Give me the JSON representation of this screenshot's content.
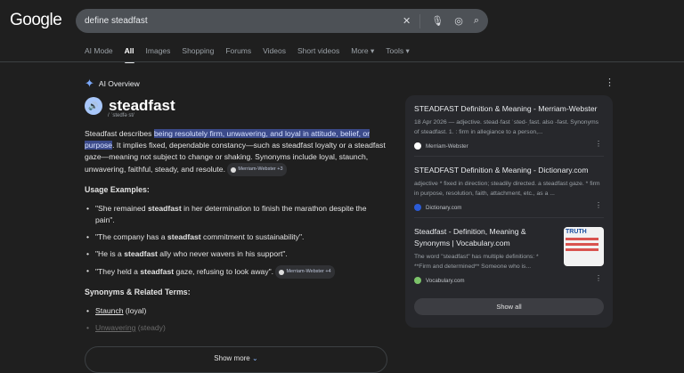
{
  "header": {
    "logo": "Google",
    "query": "define steadfast"
  },
  "tabs": [
    {
      "label": "AI Mode"
    },
    {
      "label": "All",
      "active": true
    },
    {
      "label": "Images"
    },
    {
      "label": "Shopping"
    },
    {
      "label": "Forums"
    },
    {
      "label": "Videos"
    },
    {
      "label": "Short videos"
    },
    {
      "label": "More ▾"
    },
    {
      "label": "Tools ▾"
    }
  ],
  "overview": {
    "label": "AI Overview",
    "word": "steadfast",
    "pronunciation": "/ ˈstedfə st/",
    "desc_before": "Steadfast describes ",
    "desc_highlight": "being resolutely firm, unwavering, and loyal in attitude, belief, or purpose",
    "desc_after": ". It implies fixed, dependable constancy—such as steadfast loyalty or a steadfast gaze—meaning not subject to change or shaking. Synonyms include loyal, staunch, unwavering, faithful, steady, and resolute.",
    "desc_cite": "Merriam-Webster +3",
    "usage_heading": "Usage Examples:",
    "examples": [
      {
        "before": "\"She remained ",
        "bold": "steadfast",
        "after": " in her determination to finish the marathon despite the pain\"."
      },
      {
        "before": "\"The company has a ",
        "bold": "steadfast",
        "after": " commitment to sustainability\"."
      },
      {
        "before": "\"He is a ",
        "bold": "steadfast",
        "after": " ally who never wavers in his support\"."
      },
      {
        "before": "\"They held a ",
        "bold": "steadfast",
        "after": " gaze, refusing to look away\".",
        "cite": "Merriam-Webster +4"
      }
    ],
    "synonyms_heading": "Synonyms & Related Terms:",
    "synonyms": [
      {
        "term": "Staunch",
        "note": " (loyal)"
      },
      {
        "term": "Unwavering",
        "note": " (steady)"
      }
    ],
    "show_more": "Show more"
  },
  "sources": [
    {
      "title": "STEADFAST Definition & Meaning - Merriam-Webster",
      "snippet": "18 Apr 2026 — adjective. stead·fast ˈsted-ˌfast. also -fəst. Synonyms of steadfast. 1. : firm in allegiance to a person,...",
      "site": "Merriam-Webster",
      "color": "#ffffff"
    },
    {
      "title": "STEADFAST Definition & Meaning - Dictionary.com",
      "snippet": "adjective * fixed in direction; steadily directed. a steadfast gaze. * firm in purpose, resolution, faith, attachment, etc., as a ...",
      "site": "Dictionary.com",
      "color": "#2b5bd7"
    },
    {
      "title": "Steadfast - Definition, Meaning & Synonyms | Vocabulary.com",
      "snippet": "The word \"steadfast\" has multiple definitions: * **Firm and determined** Someone who is...",
      "site": "Vocabulary.com",
      "color": "#7cc36a",
      "thumb": "TRUTH"
    }
  ],
  "show_all": "Show all"
}
